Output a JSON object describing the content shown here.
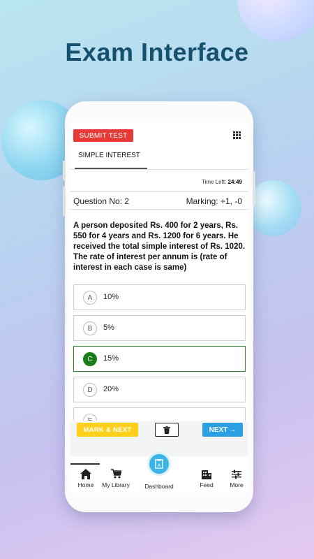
{
  "headline": "Exam Interface",
  "exam": {
    "submit_label": "SUBMIT TEST",
    "section_tab": "SIMPLE INTEREST",
    "time_left_label": "Time Left:",
    "time_left_value": "24:49",
    "question_no": "Question No: 2",
    "marking": "Marking: +1, -0",
    "question_text": "A person deposited Rs. 400 for 2 years, Rs. 550 for 4 years and Rs. 1200 for 6 years. He received the total simple interest of Rs. 1020. The rate of interest per annum is (rate of interest in each case is same)",
    "options": [
      {
        "letter": "A",
        "text": "10%"
      },
      {
        "letter": "B",
        "text": "5%"
      },
      {
        "letter": "C",
        "text": "15%"
      },
      {
        "letter": "D",
        "text": "20%"
      },
      {
        "letter": "E",
        "text": ""
      }
    ],
    "selected_option": "C",
    "mark_next_label": "MARK & NEXT",
    "next_label": "NEXT",
    "next_arrow": "→"
  },
  "nav": {
    "items": [
      {
        "label": "Home",
        "icon": "home-icon"
      },
      {
        "label": "My Library",
        "icon": "cart-icon"
      },
      {
        "label": "Dashboard",
        "icon": "dashboard-icon"
      },
      {
        "label": "Feed",
        "icon": "building-icon"
      },
      {
        "label": "More",
        "icon": "sliders-icon"
      }
    ]
  },
  "colors": {
    "headline": "#15516f",
    "submit": "#e53a35",
    "mark_next": "#ffd019",
    "next": "#2c9fe0",
    "selected": "#1a7d1a",
    "dashboard": "#3bb4e6"
  }
}
